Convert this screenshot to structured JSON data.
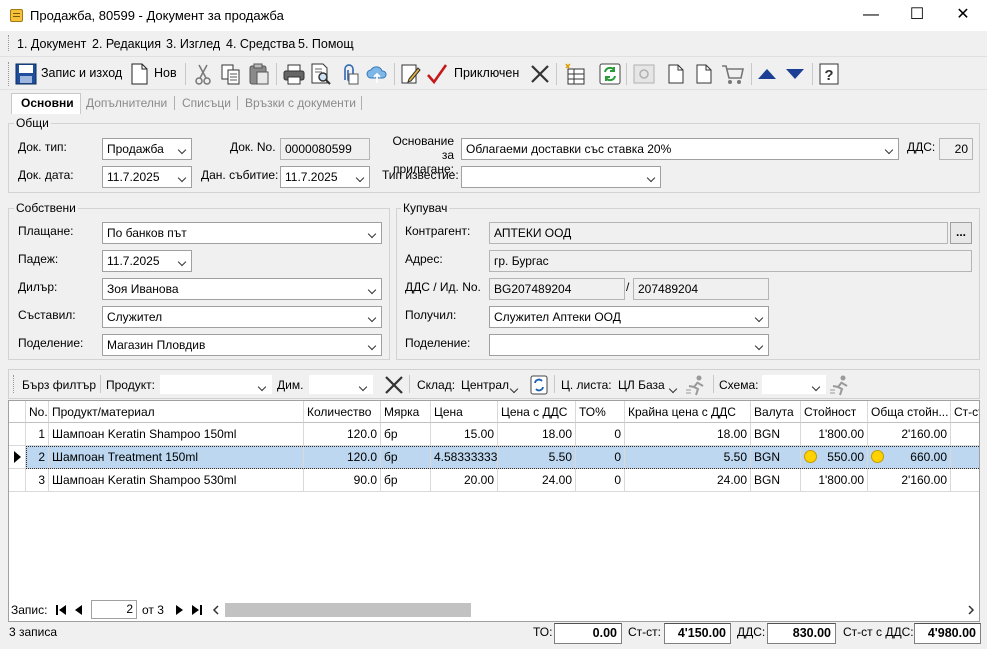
{
  "window": {
    "title": "Продажба, 80599 - Документ за продажба",
    "minimize": "—",
    "maximize": "☐",
    "close": "✕"
  },
  "menu": [
    "1. Документ",
    "2. Редакция",
    "3. Изглед",
    "4. Средства",
    "5. Помощ"
  ],
  "toolbar": {
    "save_exit": "Запис и изход",
    "new": "Нов",
    "completed": "Приключен"
  },
  "tabs": [
    "Основни",
    "Допълнителни",
    "Списъци",
    "Връзки с документи"
  ],
  "general": {
    "title": "Общи",
    "doc_type_label": "Док. тип:",
    "doc_type": "Продажба",
    "doc_no_label": "Док. No.",
    "doc_no": "0000080599",
    "basis_label_1": "Основание",
    "basis_label_2": "за прилагане:",
    "basis": "Облагаеми доставки със ставка 20%",
    "vat_label": "ДДС:",
    "vat": "20",
    "doc_date_label": "Док. дата:",
    "doc_date": "11.7.2025",
    "tax_event_label": "Дан. събитие:",
    "tax_event": "11.7.2025",
    "notice_type_label": "Тип известие:",
    "notice_type": ""
  },
  "own": {
    "title": "Собствени",
    "payment_label": "Плащане:",
    "payment": "По банков път",
    "due_label": "Падеж:",
    "due": "11.7.2025",
    "dealer_label": "Дилър:",
    "dealer": "Зоя Иванова",
    "author_label": "Съставил:",
    "author": "Служител",
    "division_label": "Поделение:",
    "division": "Магазин Пловдив"
  },
  "buyer": {
    "title": "Купувач",
    "partner_label": "Контрагент:",
    "partner": "АПТЕКИ ООД",
    "browse": "...",
    "address_label": "Адрес:",
    "address": "гр. Бургас",
    "vat_id_label": "ДДС / Ид. No.",
    "vat_no": "BG207489204",
    "slash": "/",
    "id_no": "207489204",
    "receiver_label": "Получил:",
    "receiver": "Служител Аптеки ООД",
    "division_label": "Поделение:",
    "division": ""
  },
  "filter": {
    "quick": "Бърз филтър",
    "product_label": "Продукт:",
    "product": "",
    "dim_label": "Дим.",
    "dim": "",
    "warehouse_label": "Склад:",
    "warehouse": "Централ",
    "pricelist_label": "Ц. листа:",
    "pricelist": "ЦЛ База",
    "scheme_label": "Схема:",
    "scheme": ""
  },
  "grid": {
    "columns": [
      "No.",
      "Продукт/материал",
      "Количество",
      "Мярка",
      "Цена",
      "Цена с ДДС",
      "ТО%",
      "Крайна цена с ДДС",
      "Валута",
      "Стойност",
      "Обща стойн...",
      "Ст-ст"
    ],
    "rows": [
      {
        "no": "1",
        "product": "Шампоан Keratin Shampoo 150ml",
        "qty": "120.0",
        "unit": "бр",
        "price": "15.00",
        "price_vat": "18.00",
        "to": "0",
        "final": "18.00",
        "currency": "BGN",
        "value": "1'800.00",
        "total": "2'160.00",
        "warn": false
      },
      {
        "no": "2",
        "product": "Шампоан Treatment 150ml",
        "qty": "120.0",
        "unit": "бр",
        "price": "4.58333333",
        "price_vat": "5.50",
        "to": "0",
        "final": "5.50",
        "currency": "BGN",
        "value": "550.00",
        "total": "660.00",
        "warn": true
      },
      {
        "no": "3",
        "product": "Шампоан Keratin Shampoo 530ml",
        "qty": "90.0",
        "unit": "бр",
        "price": "20.00",
        "price_vat": "24.00",
        "to": "0",
        "final": "24.00",
        "currency": "BGN",
        "value": "1'800.00",
        "total": "2'160.00",
        "warn": false
      }
    ]
  },
  "pager": {
    "label": "Запис:",
    "current": "2",
    "of": "от 3"
  },
  "status": {
    "records": "3 записа",
    "to_label": "ТО:",
    "to": "0.00",
    "cost_label": "Ст-ст:",
    "cost": "4'150.00",
    "vat_label": "ДДС:",
    "vat": "830.00",
    "cost_vat_label": "Ст-ст с ДДС:",
    "cost_vat": "4'980.00"
  }
}
